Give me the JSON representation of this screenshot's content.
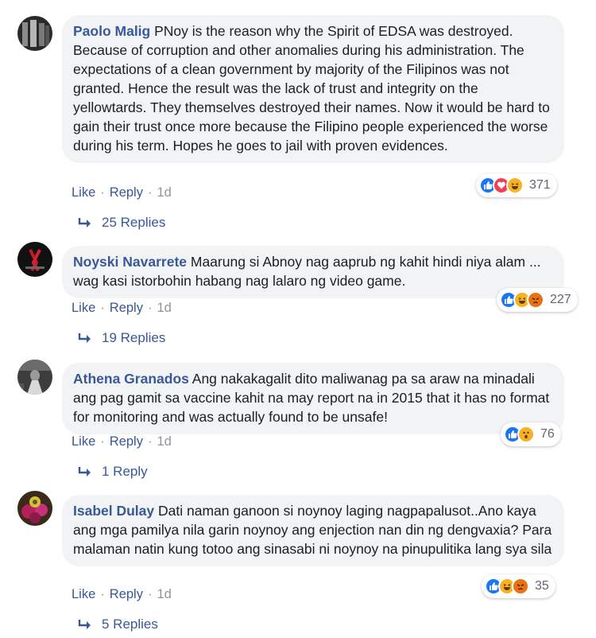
{
  "actions": {
    "like": "Like",
    "reply": "Reply",
    "separator": "·"
  },
  "colors": {
    "link": "#385898",
    "bubble": "#f2f3f5",
    "like_blue": "#1877f2",
    "love_red": "#f33e58",
    "haha_yellow": "#f7b125",
    "angry_orange": "#e9710f"
  },
  "comments": [
    {
      "author": "Paolo Malig",
      "text": "PNoy is the reason why the Spirit of EDSA was destroyed. Because of corruption and other anomalies during his administration. The expectations of a clean government by majority of the Filipinos was not granted. Hence the result was the lack of trust and integrity on the yellowtards. They themselves destroyed their names. Now it would be hard to gain their trust once more because the Filipino people experienced the worse during his term. Hopes he goes to jail with proven evidences.",
      "time": "1d",
      "reaction_icons": [
        "like-icon",
        "love-icon",
        "haha-icon"
      ],
      "reaction_count": "371",
      "replies_label": "25 Replies"
    },
    {
      "author": "Noyski Navarrete",
      "text": "Maarung si Abnoy nag aaprub ng kahit hindi niya alam ... wag kasi istorbohin habang nag lalaro ng video game.",
      "time": "1d",
      "reaction_icons": [
        "like-icon",
        "haha-icon",
        "angry-icon"
      ],
      "reaction_count": "227",
      "replies_label": "19 Replies"
    },
    {
      "author": "Athena Granados",
      "text": "Ang nakakagalit dito maliwanag pa sa araw na minadali ang pag gamit sa vaccine kahit na may report na in 2015 that it has no format for monitoring and was actually found to be unsafe!",
      "time": "1d",
      "reaction_icons": [
        "like-icon",
        "wow-icon"
      ],
      "reaction_count": "76",
      "replies_label": "1 Reply"
    },
    {
      "author": "Isabel Dulay",
      "text": "Dati naman ganoon si noynoy laging nagpapalusot..Ano kaya ang mga pamilya nila garin noynoy ang enjection nan din ng dengvaxia? Para malaman natin kung totoo ang sinasabi ni noynoy na pinupulitika lang sya sila",
      "time": "1d",
      "reaction_icons": [
        "like-icon",
        "haha-icon",
        "angry-icon"
      ],
      "reaction_count": "35",
      "replies_label": "5 Replies"
    }
  ]
}
